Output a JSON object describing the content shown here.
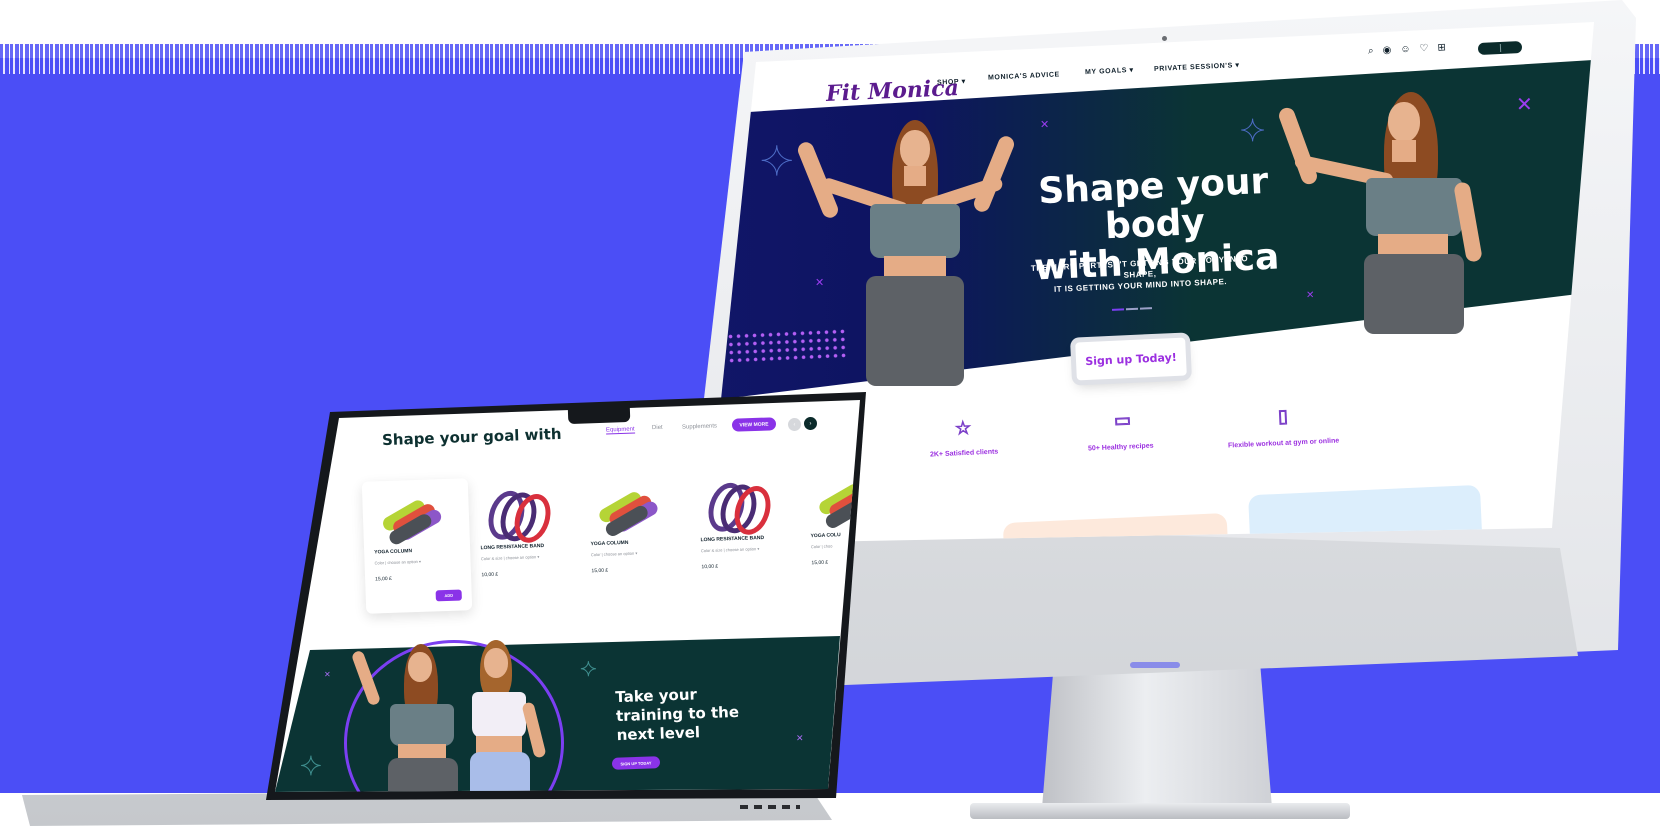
{
  "imac": {
    "logo": "Fit Monica",
    "nav": {
      "shop": "SHOP",
      "advice": "MONICA'S ADVICE",
      "goals": "MY GOALS",
      "private": "PRIVATE SESSION'S"
    },
    "hero": {
      "title": "Shape your body\nwith Monica",
      "subtitle": "THE HARD PART ISN'T GETTING YOUR BODY INTO SHAPE,\nIT IS GETTING YOUR MIND INTO SHAPE."
    },
    "signup_label": "Sign up Today!",
    "features": [
      {
        "icon": "star-icon",
        "label": "2K+ Satisfied clients"
      },
      {
        "icon": "book-icon",
        "label": "50+ Healthy recipes"
      },
      {
        "icon": "phone-icon",
        "label": "Flexible workout at gym or online"
      }
    ]
  },
  "laptop": {
    "title": "Shape your goal with",
    "tabs": [
      "Equipment",
      "Diet",
      "Supplements"
    ],
    "view_more": "VIEW MORE",
    "products": [
      {
        "name": "YOGA COLUMN",
        "color_label": "Color",
        "option": "choose an option",
        "price": "15,00 £",
        "add": "ADD"
      },
      {
        "name": "LONG RESISTANCE BAND",
        "color_label": "Color & size",
        "option": "choose an option",
        "price": "10,00 £"
      },
      {
        "name": "YOGA COLUMN",
        "color_label": "Color",
        "option": "choose an option",
        "price": "15,00 £"
      },
      {
        "name": "LONG RESISTANCE BAND",
        "color_label": "Color & size",
        "option": "choose an option",
        "price": "10,00 £"
      },
      {
        "name": "YOGA COLU",
        "color_label": "Color",
        "option": "choo",
        "price": "15,00 £"
      }
    ],
    "promo": {
      "title": "Take your\ntraining to the\nnext level",
      "button": "SIGN UP TODAY"
    }
  },
  "colors": {
    "background_blue": "#4b4ef6",
    "accent_purple": "#8a33e8",
    "dark_teal": "#0b3434",
    "hero_navy": "#12166a"
  }
}
